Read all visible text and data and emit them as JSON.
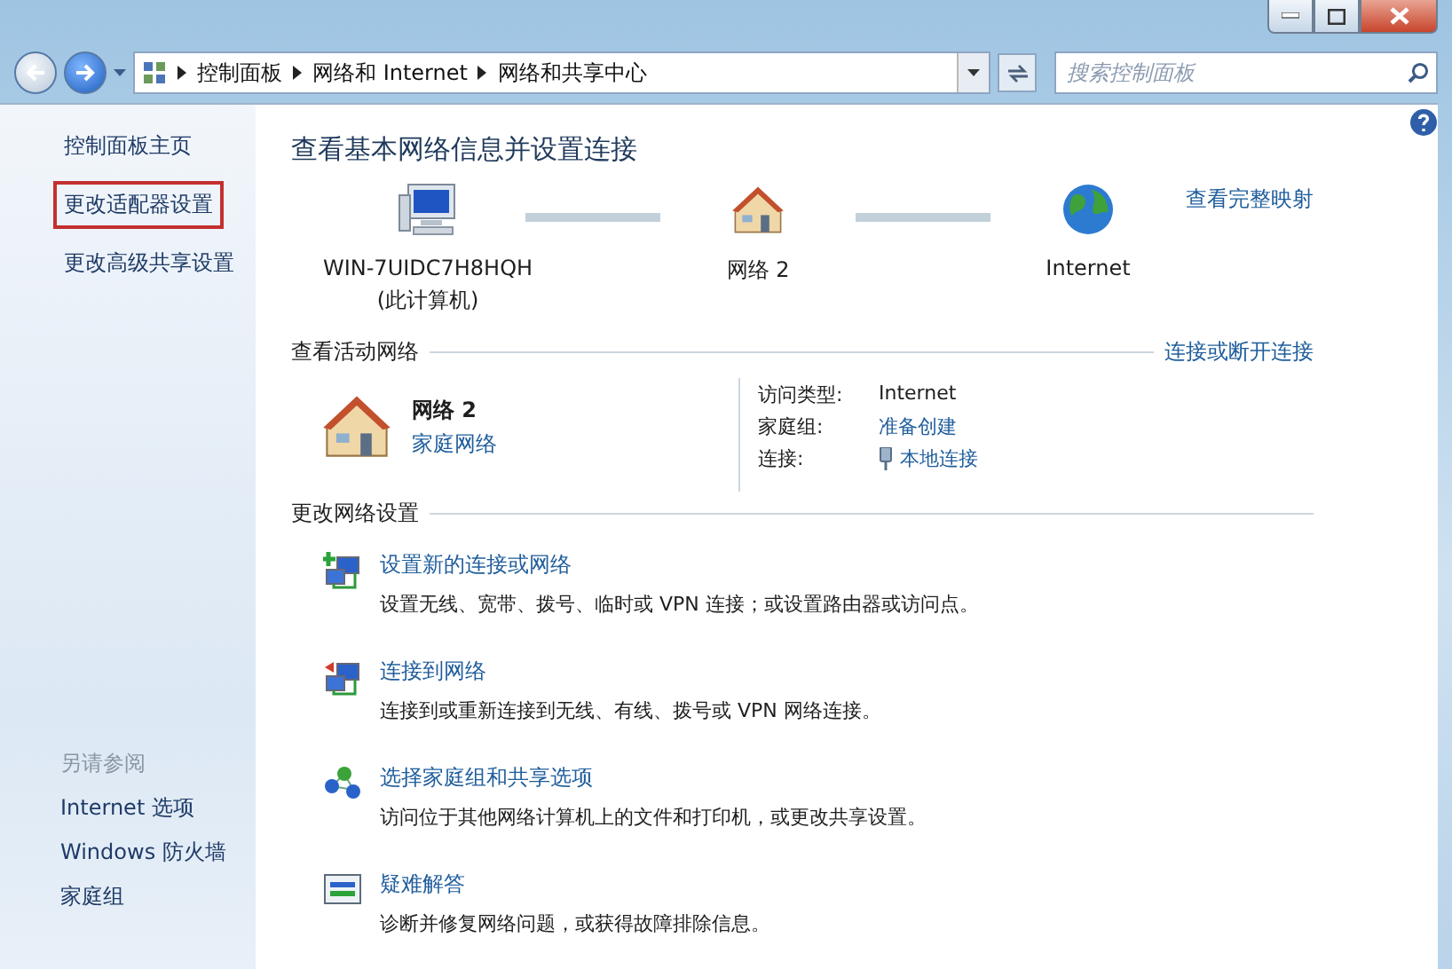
{
  "address_bar": {
    "breadcrumbs": [
      "控制面板",
      "网络和 Internet",
      "网络和共享中心"
    ]
  },
  "search": {
    "placeholder": "搜索控制面板"
  },
  "sidebar": {
    "items": [
      {
        "label": "控制面板主页",
        "highlighted": false
      },
      {
        "label": "更改适配器设置",
        "highlighted": true
      },
      {
        "label": "更改高级共享设置",
        "highlighted": false
      }
    ],
    "see_also": {
      "heading": "另请参阅",
      "items": [
        "Internet 选项",
        "Windows 防火墙",
        "家庭组"
      ]
    }
  },
  "main": {
    "title": "查看基本网络信息并设置连接",
    "map": {
      "nodes": [
        {
          "kind": "computer",
          "label": "WIN-7UIDC7H8HQH",
          "sublabel": "(此计算机)"
        },
        {
          "kind": "house",
          "label": "网络  2"
        },
        {
          "kind": "globe",
          "label": "Internet"
        }
      ],
      "link": "查看完整映射"
    },
    "active_networks": {
      "heading": "查看活动网络",
      "link": "连接或断开连接",
      "name": "网络  2",
      "type": "家庭网络",
      "details": [
        {
          "label": "访问类型:",
          "value": "Internet",
          "kind": "text"
        },
        {
          "label": "家庭组:",
          "value": "准备创建",
          "kind": "link"
        },
        {
          "label": "连接:",
          "value": "本地连接",
          "kind": "connection"
        }
      ]
    },
    "settings": {
      "heading": "更改网络设置",
      "tasks": [
        {
          "kind": "new",
          "title": "设置新的连接或网络",
          "description": "设置无线、宽带、拨号、临时或 VPN 连接；或设置路由器或访问点。"
        },
        {
          "kind": "connect",
          "title": "连接到网络",
          "description": "连接到或重新连接到无线、有线、拨号或 VPN 网络连接。"
        },
        {
          "kind": "homegroup",
          "title": "选择家庭组和共享选项",
          "description": "访问位于其他网络计算机上的文件和打印机，或更改共享设置。"
        },
        {
          "kind": "troubleshoot",
          "title": "疑难解答",
          "description": "诊断并修复网络问题，或获得故障排除信息。"
        }
      ]
    }
  }
}
